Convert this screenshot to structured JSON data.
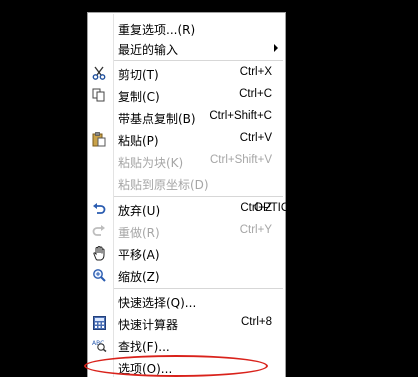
{
  "context_menu": {
    "items": [
      {
        "label": "重复选项...(R)",
        "shortcut": "",
        "icon": "",
        "disabled": false
      },
      {
        "label": "最近的输入",
        "shortcut": "",
        "icon": "",
        "disabled": false,
        "submenu": true
      },
      {
        "label": "剪切(T)",
        "shortcut": "Ctrl+X",
        "icon": "scissors-icon",
        "disabled": false
      },
      {
        "label": "复制(C)",
        "shortcut": "Ctrl+C",
        "icon": "copy-icon",
        "disabled": false
      },
      {
        "label": "带基点复制(B)",
        "shortcut": "Ctrl+Shift+C",
        "icon": "",
        "disabled": false
      },
      {
        "label": "粘贴(P)",
        "shortcut": "Ctrl+V",
        "icon": "paste-icon",
        "disabled": false
      },
      {
        "label": "粘贴为块(K)",
        "shortcut": "Ctrl+Shift+V",
        "icon": "",
        "disabled": true
      },
      {
        "label": "粘贴到原坐标(D)",
        "shortcut": "",
        "icon": "",
        "disabled": true
      },
      {
        "label": "放弃(U)",
        "extra": "OPTIONS",
        "shortcut": "Ctrl+Z",
        "icon": "undo-icon",
        "disabled": false
      },
      {
        "label": "重做(R)",
        "shortcut": "Ctrl+Y",
        "icon": "redo-icon",
        "disabled": true
      },
      {
        "label": "平移(A)",
        "shortcut": "",
        "icon": "hand-icon",
        "disabled": false
      },
      {
        "label": "缩放(Z)",
        "shortcut": "",
        "icon": "zoom-icon",
        "disabled": false
      },
      {
        "label": "快速选择(Q)...",
        "shortcut": "",
        "icon": "",
        "disabled": false
      },
      {
        "label": "快速计算器",
        "shortcut": "Ctrl+8",
        "icon": "calculator-icon",
        "disabled": false
      },
      {
        "label": "查找(F)...",
        "shortcut": "",
        "icon": "find-icon",
        "disabled": false
      },
      {
        "label": "选项(O)...",
        "shortcut": "",
        "icon": "",
        "disabled": false
      }
    ]
  },
  "colors": {
    "background": "#000000",
    "menu_bg": "#ffffff",
    "disabled_text": "#a6a6a6",
    "highlight_ellipse": "#d9221b"
  }
}
